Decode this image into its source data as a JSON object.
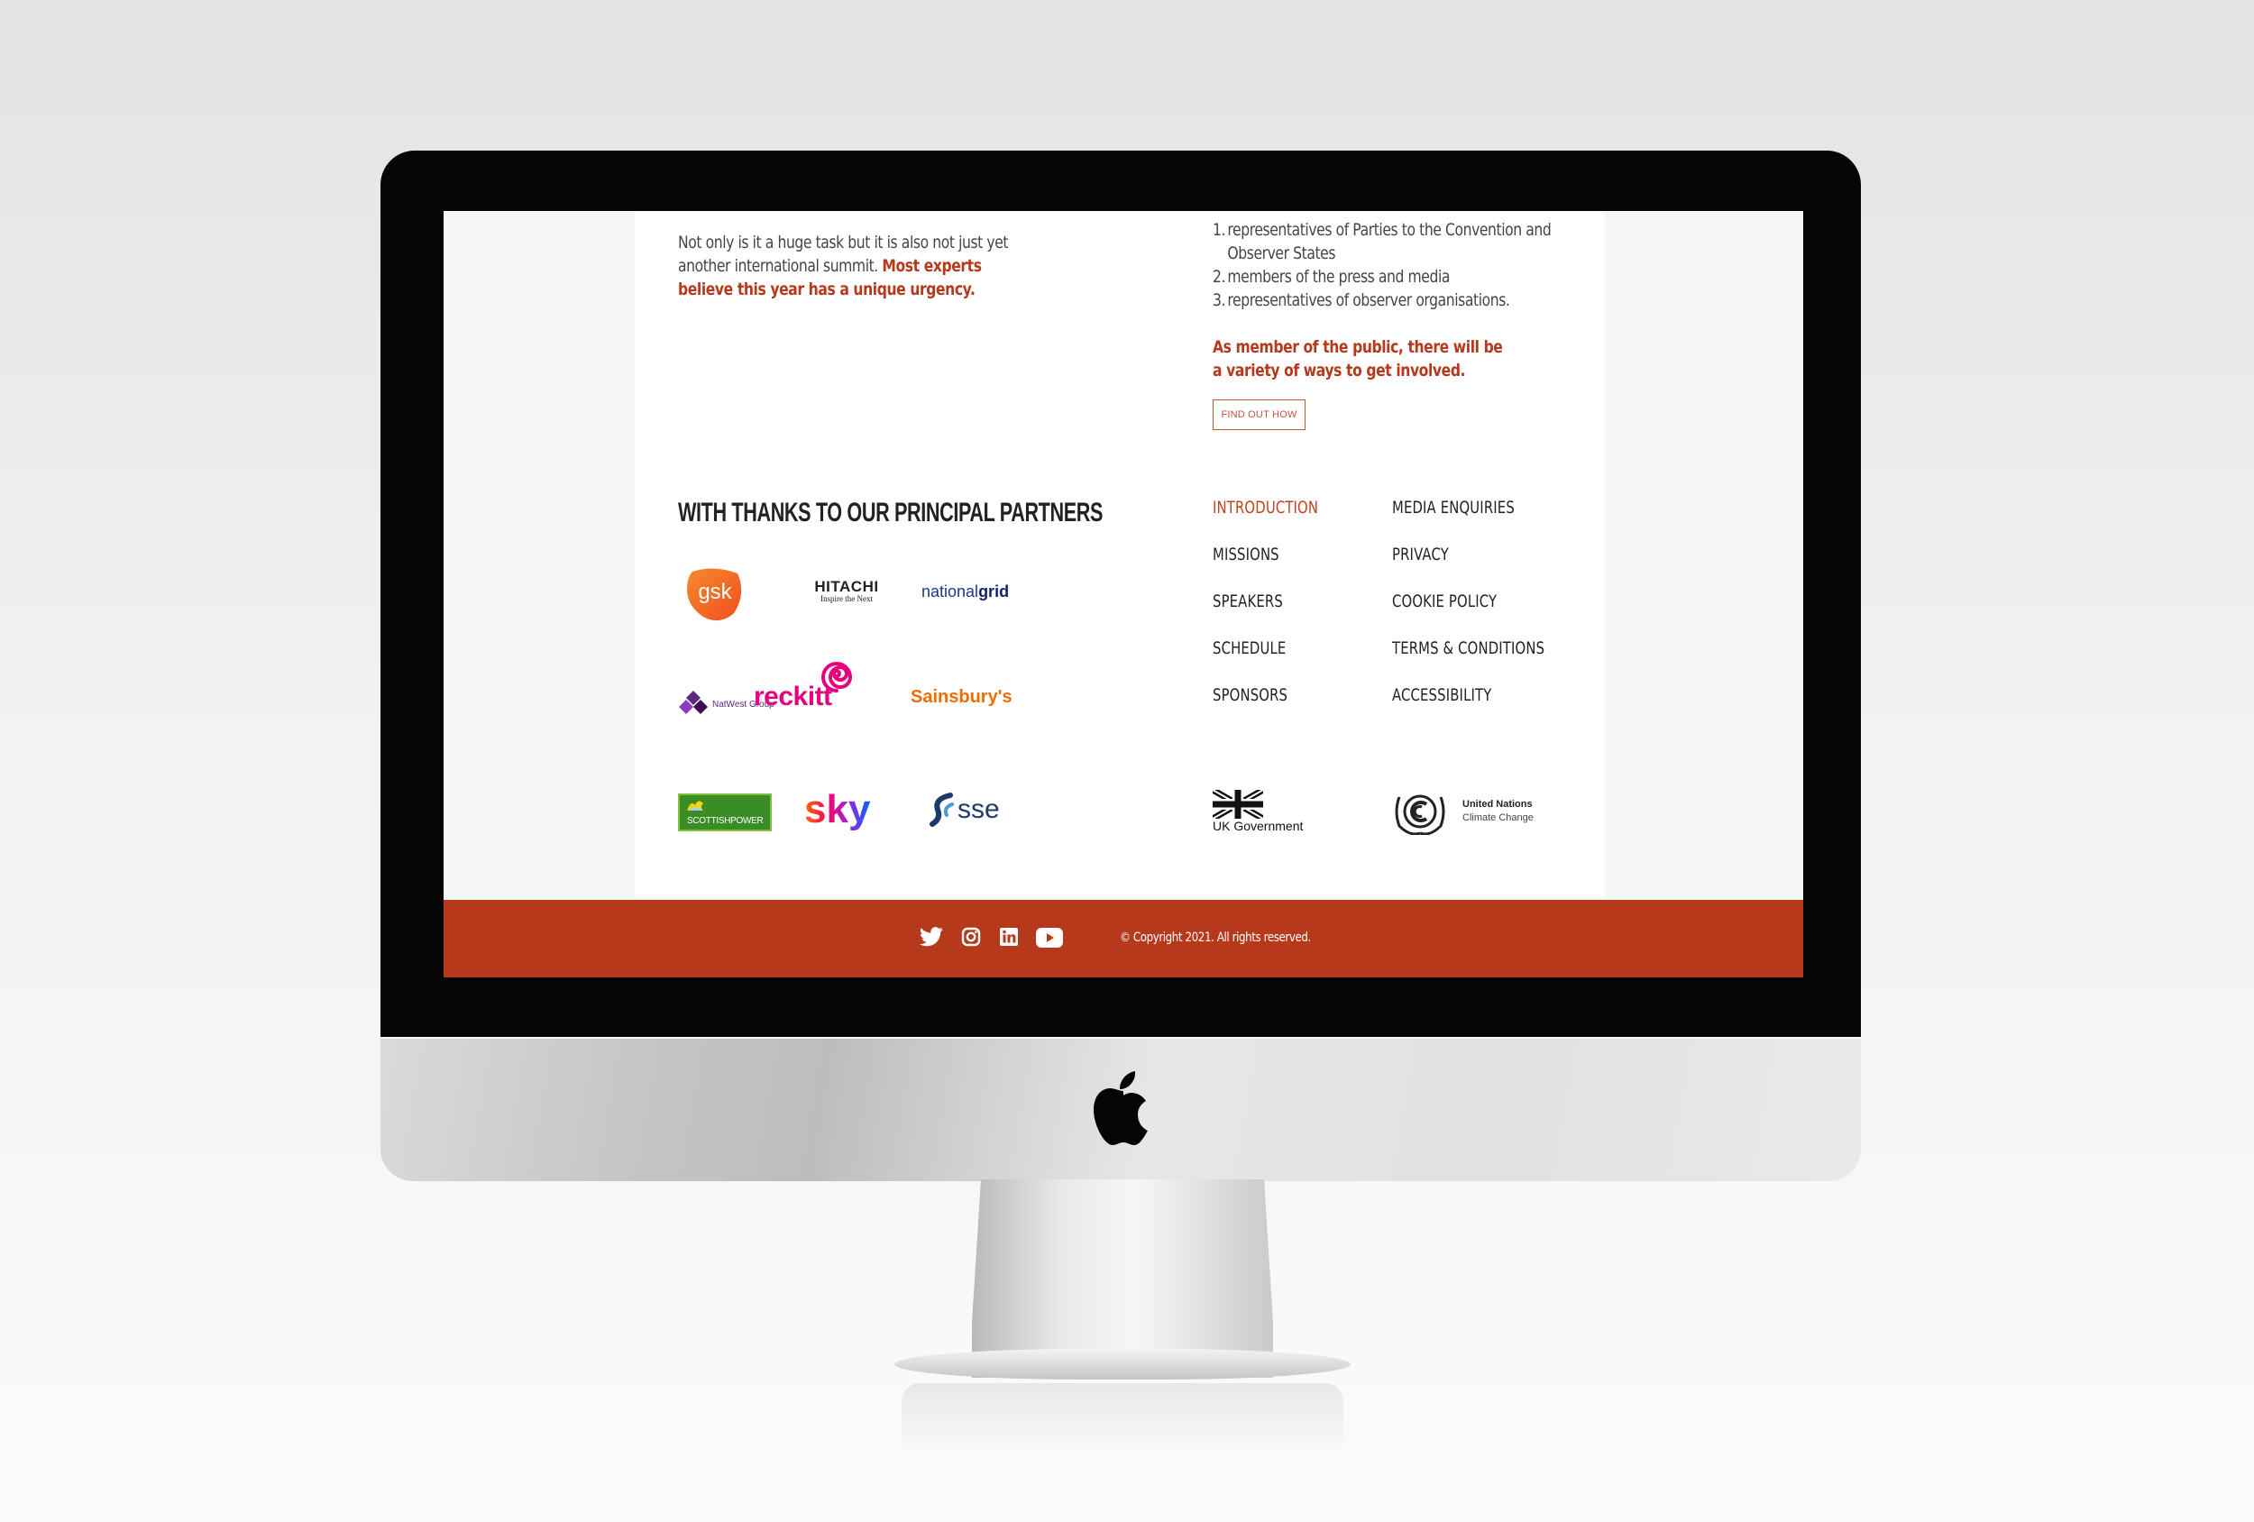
{
  "intro": {
    "text": "Not only is it a huge task but it is also not just yet another international summit.",
    "highlight": "Most experts believe this year has a unique urgency."
  },
  "attendance": {
    "items": [
      {
        "num": "1.",
        "text": "representatives of Parties to the Convention and Observer States"
      },
      {
        "num": "2.",
        "text": "members of the press and media"
      },
      {
        "num": "3.",
        "text": "representatives of observer organisations."
      }
    ],
    "public_note": "As member of the public, there will be a variety of ways to get involved.",
    "find_out_label": "FIND OUT HOW"
  },
  "partners": {
    "title": "WITH THANKS TO OUR PRINCIPAL PARTNERS",
    "gsk": "gsk",
    "hitachi_name": "HITACHI",
    "hitachi_tagline": "Inspire the Next",
    "nationalgrid_a": "national",
    "nationalgrid_b": "grid",
    "natwest": "NatWest Group",
    "reckitt": "reckitt",
    "sainsburys": "Sainsbury's",
    "scottishpower": "SCOTTISHPOWER",
    "sky": "sky",
    "sse": "sse"
  },
  "nav": {
    "col1": [
      "INTRODUCTION",
      "MISSIONS",
      "SPEAKERS",
      "SCHEDULE",
      "SPONSORS"
    ],
    "col2": [
      "MEDIA ENQUIRIES",
      "PRIVACY",
      "COOKIE POLICY",
      "TERMS & CONDITIONS",
      "ACCESSIBILITY"
    ]
  },
  "gov_logos": {
    "uk_gov": "UK Government",
    "un_line1": "United Nations",
    "un_line2": "Climate Change"
  },
  "footer": {
    "copyright": "© Copyright 2021. All rights reserved.",
    "social": [
      "twitter-icon",
      "instagram-icon",
      "linkedin-icon",
      "youtube-icon"
    ]
  },
  "colors": {
    "accent": "#b5391a",
    "footer_bg": "#b5391a"
  }
}
